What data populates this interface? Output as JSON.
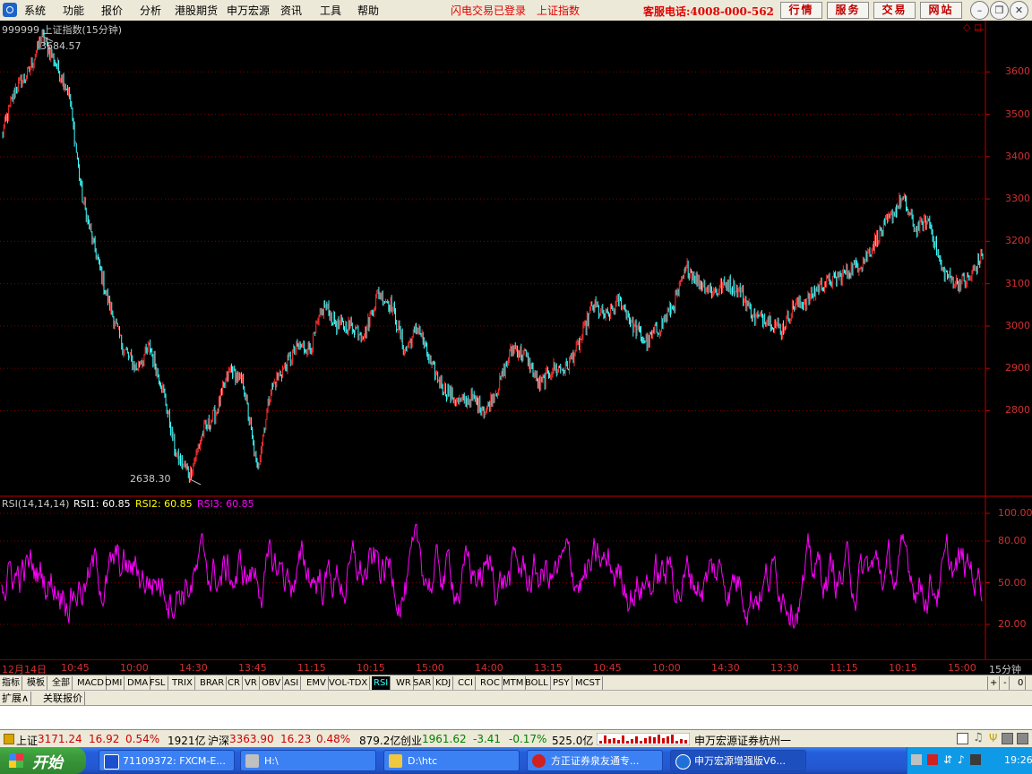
{
  "menubar": {
    "items": [
      "系统",
      "功能",
      "报价",
      "分析",
      "港股期货",
      "申万宏源",
      "资讯",
      "工具",
      "帮助"
    ],
    "status": [
      "闪电交易已登录",
      "上证指数"
    ],
    "hotline": "客服电话:4008-000-562",
    "buttons": [
      "行情",
      "服务",
      "交易",
      "网站"
    ]
  },
  "chart": {
    "header": "999999 上证指数(15分钟)",
    "high_label": "3684.57",
    "low_label": "2638.30",
    "price_ticks": [
      "3600",
      "3500",
      "3400",
      "3300",
      "3200",
      "3100",
      "3000",
      "2900",
      "2800"
    ],
    "rsi_header": {
      "title": "RSI(14,14,14)",
      "rsi1": "RSI1: 60.85",
      "rsi2": "RSI2: 60.85",
      "rsi3": "RSI3: 60.85"
    },
    "rsi_ticks": [
      "100.00",
      "80.00",
      "50.00",
      "20.00"
    ],
    "time_ticks": [
      "12月14日",
      "10:45",
      "10:00",
      "14:30",
      "13:45",
      "11:15",
      "10:15",
      "15:00",
      "14:00",
      "13:15",
      "10:45",
      "10:00",
      "14:30",
      "13:30",
      "11:15",
      "10:15",
      "15:00"
    ],
    "period": "15分钟",
    "colors": {
      "up": "#ff3030",
      "down": "#40ffff",
      "rsi": "#ff00ff",
      "axis": "#c00000",
      "grid": "#800000",
      "rsi2": "#ffff00"
    }
  },
  "chart_data": {
    "type": "line",
    "title": "999999 上证指数(15分钟)",
    "ylim": [
      2600,
      3700
    ],
    "annotations": [
      {
        "label": "3684.57",
        "value": 3684.57
      },
      {
        "label": "2638.30",
        "value": 2638.3
      }
    ],
    "series": [
      {
        "name": "上证指数",
        "x": [
          0,
          1,
          2,
          3,
          4,
          5,
          6,
          7,
          8,
          9,
          10,
          11,
          12,
          13,
          14,
          15,
          16,
          17,
          18,
          19,
          20,
          21,
          22,
          23,
          24,
          25,
          26,
          27,
          28,
          29,
          30,
          31,
          32,
          33,
          34,
          35,
          36,
          37,
          38,
          39,
          40,
          41,
          42,
          43,
          44,
          45,
          46,
          47,
          48,
          49,
          50,
          51,
          52,
          53,
          54,
          55,
          56,
          57,
          58,
          59,
          60,
          61,
          62,
          63,
          64,
          65,
          66,
          67,
          68,
          69,
          70,
          71,
          72,
          73
        ],
        "values": [
          3450,
          3560,
          3600,
          3684,
          3620,
          3550,
          3300,
          3170,
          3050,
          2950,
          2900,
          2950,
          2850,
          2690,
          2650,
          2750,
          2800,
          2900,
          2860,
          2660,
          2850,
          2900,
          2950,
          2950,
          3050,
          3000,
          3000,
          2980,
          3080,
          3050,
          2940,
          3000,
          2900,
          2850,
          2820,
          2830,
          2800,
          2860,
          2950,
          2930,
          2860,
          2900,
          2900,
          2960,
          3050,
          3020,
          3060,
          3000,
          2960,
          3000,
          3050,
          3140,
          3100,
          3080,
          3100,
          3080,
          3020,
          3020,
          2990,
          3050,
          3060,
          3100,
          3110,
          3130,
          3150,
          3200,
          3250,
          3300,
          3230,
          3250,
          3130,
          3100,
          3110,
          3170
        ]
      }
    ]
  },
  "indicators": [
    "指标",
    "模板",
    "全部",
    "MACD",
    "DMI",
    "DMA",
    "FSL",
    "TRIX",
    "BRAR",
    "CR",
    "VR",
    "OBV",
    "ASI",
    "EMV",
    "VOL-TDX",
    "RSI",
    "WR",
    "SAR",
    "KDJ",
    "CCI",
    "ROC",
    "MTM",
    "BOLL",
    "PSY",
    "MCST"
  ],
  "indicator_controls": [
    "+",
    "-",
    "0"
  ],
  "ext_tabs": [
    "扩展∧",
    "关联报价"
  ],
  "quotes": {
    "sh_name": "上证",
    "sh_price": "3171.24",
    "sh_change": "16.92",
    "sh_pct": "0.54%",
    "sh_amount": "1921亿",
    "hs_name": "沪深",
    "hs_price": "3363.90",
    "hs_change": "16.23",
    "hs_pct": "0.48%",
    "hs_amount": "879.2亿",
    "cy_name": "创业",
    "cy_price": "1961.62",
    "cy_change": "-3.41",
    "cy_pct": "-0.17%",
    "cy_amount": "525.0亿",
    "broker": "申万宏源证券杭州一"
  },
  "taskbar": {
    "start": "开始",
    "tasks": [
      "71109372: FXCM-E...",
      "H:\\",
      "D:\\htc",
      "方正证券泉友通专...",
      "申万宏源增强版V6..."
    ],
    "clock": "19:26"
  }
}
